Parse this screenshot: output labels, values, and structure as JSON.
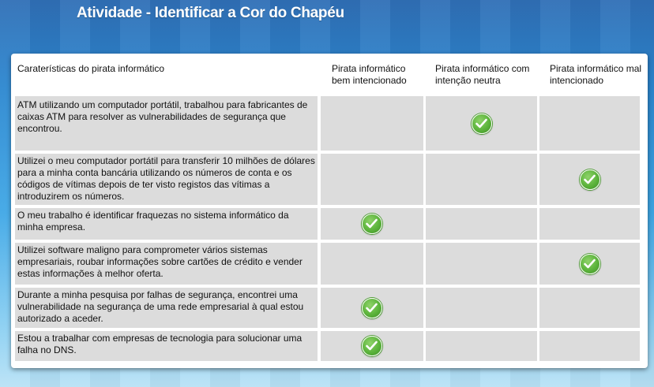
{
  "title": "Atividade - Identificar a Cor do Chapéu",
  "table": {
    "headers": [
      "Caraterísticas do pirata informático",
      "Pirata informático bem intencionado",
      "Pirata informático com intenção neutra",
      "Pirata informático mal intencionado"
    ],
    "rows": [
      {
        "text": "ATM utilizando um computador portátil, trabalhou para fabricantes de caixas ATM para resolver as vulnerabilidades de segurança que encontrou.",
        "check_column": 2
      },
      {
        "text": "Utilizei o meu computador portátil para transferir 10 milhões de dólares para a minha conta bancária utilizando os números de conta e os códigos de vítimas depois de ter visto registos das vítimas a introduzirem os números.",
        "check_column": 3
      },
      {
        "text": "O meu trabalho é identificar fraquezas no sistema informático da minha empresa.",
        "check_column": 1
      },
      {
        "text": "Utilizei software maligno para comprometer vários sistemas empresariais, roubar informações sobre cartões de crédito e vender estas informações à melhor oferta.",
        "check_column": 3
      },
      {
        "text": "Durante a minha pesquisa por falhas de segurança, encontrei uma vulnerabilidade na segurança de uma rede empresarial à qual estou autorizado a aceder.",
        "check_column": 1
      },
      {
        "text": "Estou a trabalhar com empresas de tecnologia para solucionar uma falha no DNS.",
        "check_column": 1
      }
    ]
  },
  "colors": {
    "check_green": "#5bb33b",
    "cell_gray": "#dcdcdc"
  },
  "icons": {
    "check": "check-circle-icon"
  }
}
